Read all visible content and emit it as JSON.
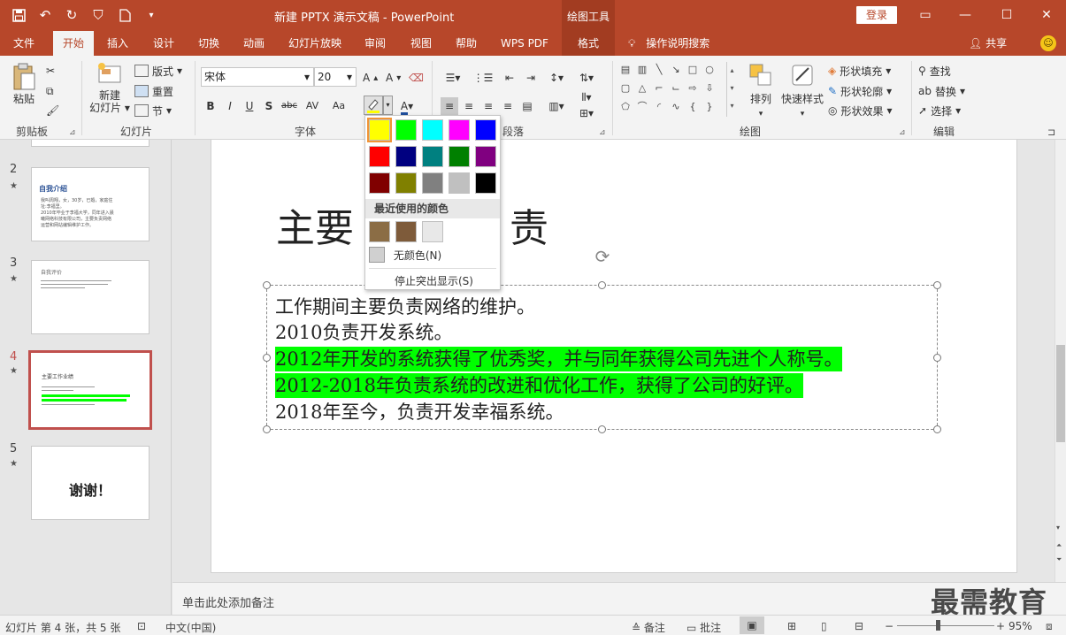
{
  "titlebar": {
    "title": "新建 PPTX 演示文稿 - PowerPoint",
    "drawing_tools": "绘图工具",
    "login": "登录",
    "qat_icons": [
      "save-icon",
      "undo-icon",
      "redo-icon",
      "present-icon",
      "new-file-icon",
      "customize-icon"
    ]
  },
  "tabs": {
    "items": [
      "文件",
      "开始",
      "插入",
      "设计",
      "切换",
      "动画",
      "幻灯片放映",
      "审阅",
      "视图",
      "帮助",
      "WPS PDF",
      "格式"
    ],
    "active": "开始",
    "tellme": "操作说明搜索",
    "share": "共享"
  },
  "ribbon": {
    "clipboard": {
      "paste": "粘贴",
      "label": "剪贴板"
    },
    "slides": {
      "new_slide": "新建\n幻灯片",
      "layout": "版式",
      "reset": "重置",
      "section": "节",
      "label": "幻灯片"
    },
    "font": {
      "name": "宋体",
      "size": "20",
      "label": "字体",
      "buttons": [
        "B",
        "I",
        "U",
        "S",
        "abc",
        "AV",
        "Aa"
      ]
    },
    "paragraph": {
      "label": "段落"
    },
    "drawing": {
      "arrange": "排列",
      "quick_styles": "快速样式",
      "shape_fill": "形状填充",
      "shape_outline": "形状轮廓",
      "shape_effects": "形状效果",
      "label": "绘图"
    },
    "editing": {
      "find": "查找",
      "replace": "替换",
      "select": "选择",
      "label": "编辑"
    }
  },
  "slides_panel": {
    "slides": [
      {
        "num": "2",
        "title": "自我介绍",
        "lines": [
          "我叫周翔，女，30岁，已婚，家庭住",
          "址:李福里。",
          "2010年毕业于李福大学，同年进入晨",
          "曦网络科技有限公司，主要负责网络",
          "运营和网站编辑维护工作。"
        ]
      },
      {
        "num": "3",
        "title": "自我评价"
      },
      {
        "num": "4",
        "title": "主要工作业绩",
        "selected": true
      },
      {
        "num": "5",
        "title": "谢谢！"
      }
    ]
  },
  "slide": {
    "title_left": "主要",
    "title_right": "责",
    "lines": [
      {
        "text": "工作期间主要负责网络的维护。",
        "highlight": false
      },
      {
        "text": "2010负责开发系统。",
        "highlight": false
      },
      {
        "text": "2012年开发的系统获得了优秀奖，并与同年获得公司先进个人称号。",
        "highlight": true
      },
      {
        "text": "2012-2018年负责系统的改进和优化工作，获得了公司的好评。",
        "highlight": true
      },
      {
        "text": "2018年至今，负责开发幸福系统。",
        "highlight": false
      }
    ]
  },
  "highlight_menu": {
    "colors": [
      "#ffff00",
      "#00ff00",
      "#00ffff",
      "#ff00ff",
      "#0000ff",
      "#ff0000",
      "#000080",
      "#008080",
      "#008000",
      "#800080",
      "#800000",
      "#808000",
      "#808080",
      "#c0c0c0",
      "#000000"
    ],
    "selected_index": 0,
    "recent_header": "最近使用的颜色",
    "recent_colors": [
      "#8b6d45",
      "#7e5b3a",
      "#e8e8e8"
    ],
    "no_color": "无颜色(N)",
    "stop": "停止突出显示(S)"
  },
  "notes": {
    "placeholder": "单击此处添加备注"
  },
  "watermark": "最需教育",
  "status": {
    "slide_info": "幻灯片 第 4 张，共 5 张",
    "language": "中文(中国)",
    "notes_btn": "备注",
    "comments_btn": "批注",
    "zoom": "95%"
  }
}
